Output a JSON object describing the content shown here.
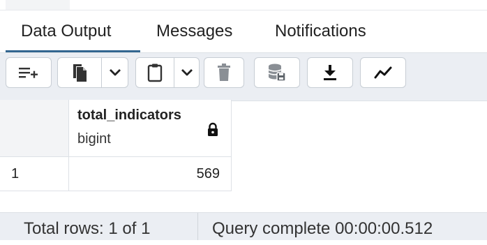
{
  "tabs": [
    {
      "label": "Data Output",
      "active": true
    },
    {
      "label": "Messages",
      "active": false
    },
    {
      "label": "Notifications",
      "active": false
    }
  ],
  "toolbar": {
    "buttons": [
      {
        "icon": "add-row-icon"
      },
      {
        "icon": "copy-icon"
      },
      {
        "icon": "chevron-down-icon"
      },
      {
        "icon": "paste-icon"
      },
      {
        "icon": "chevron-down-icon"
      },
      {
        "icon": "delete-icon"
      },
      {
        "icon": "save-data-icon"
      },
      {
        "icon": "download-icon"
      },
      {
        "icon": "graph-visualiser-icon"
      }
    ]
  },
  "grid": {
    "columns": [
      {
        "name": "total_indicators",
        "type": "bigint",
        "locked": true
      }
    ],
    "rows": [
      {
        "row_number": "1",
        "cells": [
          "569"
        ]
      }
    ]
  },
  "status": {
    "total_rows": "Total rows: 1 of 1",
    "query": "Query complete 00:00:00.512"
  },
  "colors": {
    "accent": "#326690",
    "toolbar_bg": "#ebeef3",
    "border": "#dde1e6"
  }
}
